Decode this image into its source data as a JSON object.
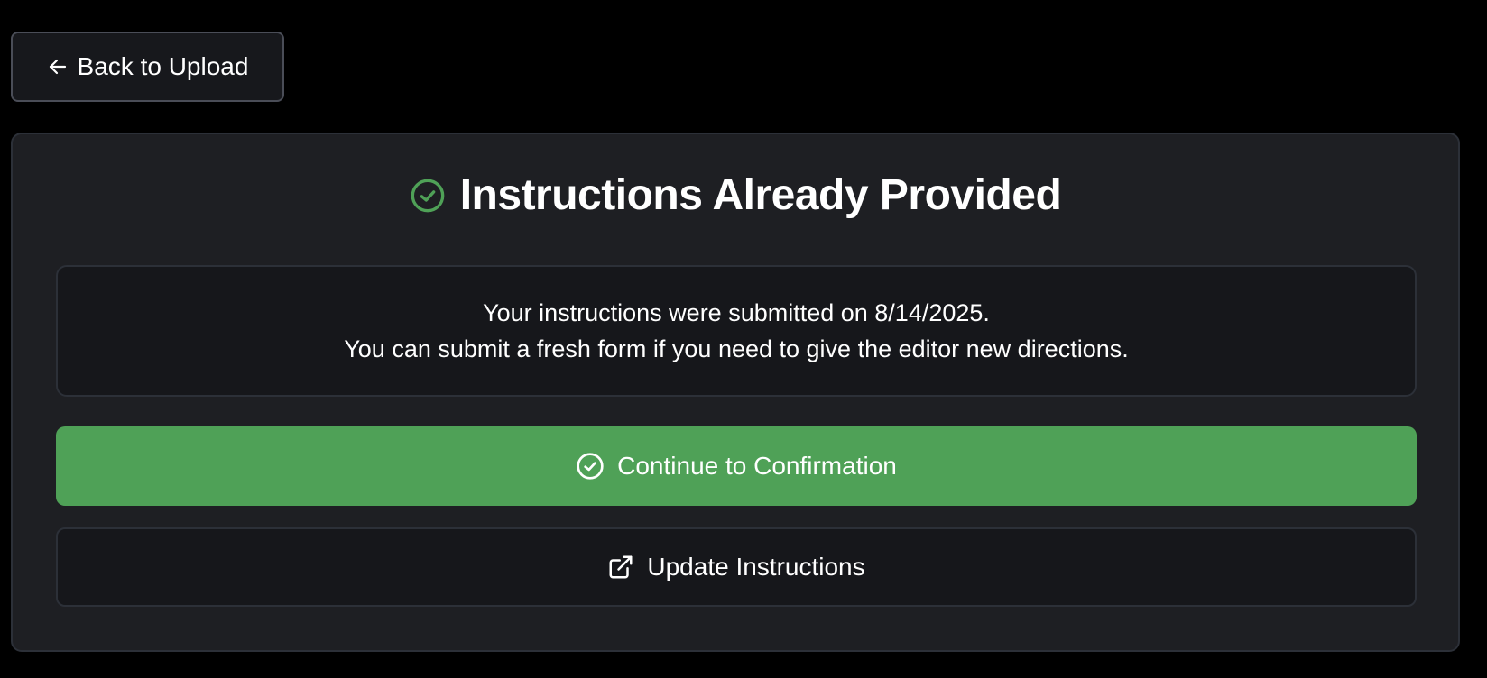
{
  "back_button": {
    "label": "Back to Upload",
    "icon": "arrow-left-icon"
  },
  "card": {
    "title": "Instructions Already Provided",
    "title_icon": "check-circle-icon",
    "message_line1": "Your instructions were submitted on 8/14/2025.",
    "message_line2": "You can submit a fresh form if you need to give the editor new directions."
  },
  "continue_button": {
    "label": "Continue to Confirmation",
    "icon": "check-circle-icon"
  },
  "update_button": {
    "label": "Update Instructions",
    "icon": "external-link-icon"
  },
  "colors": {
    "background": "#000000",
    "card_background": "#1e1f23",
    "accent_green": "#4fa157",
    "text": "#ffffff"
  }
}
